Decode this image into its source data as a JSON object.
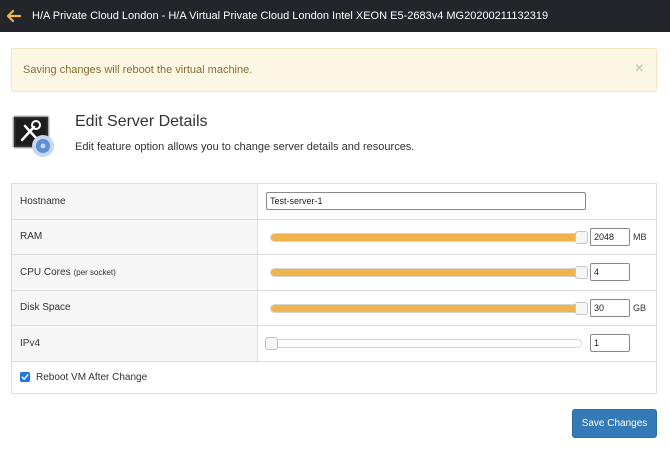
{
  "topbar": {
    "title": "H/A Private Cloud London - H/A Virtual Private Cloud London Intel XEON E5-2683v4 MG20200211132319",
    "back_icon": "arrow-left-icon",
    "back_icon_color": "#f0b44c"
  },
  "alert": {
    "message": "Saving changes will reboot the virtual machine.",
    "close_label": "×"
  },
  "header": {
    "icon": "server-settings-icon",
    "title": "Edit Server Details",
    "subtitle": "Edit feature option allows you to change server details and resources."
  },
  "form": {
    "hostname": {
      "label": "Hostname",
      "value": "Test-server-1"
    },
    "ram": {
      "label": "RAM",
      "value": "2048",
      "unit": "MB",
      "slider_fraction": 1.0
    },
    "cpu": {
      "label": "CPU Cores",
      "label_note": "(per socket)",
      "value": "4",
      "slider_fraction": 1.0
    },
    "disk": {
      "label": "Disk Space",
      "value": "30",
      "unit": "GB",
      "slider_fraction": 1.0
    },
    "ipv4": {
      "label": "IPv4",
      "value": "1",
      "slider_fraction": 0.0
    },
    "reboot": {
      "label": "Reboot VM After Change",
      "checked": true
    }
  },
  "actions": {
    "save_label": "Save Changes"
  },
  "colors": {
    "accent": "#f0b44c",
    "primary_button": "#337ab7",
    "topbar": "#22262b",
    "alert_bg": "#fcf8e3"
  }
}
